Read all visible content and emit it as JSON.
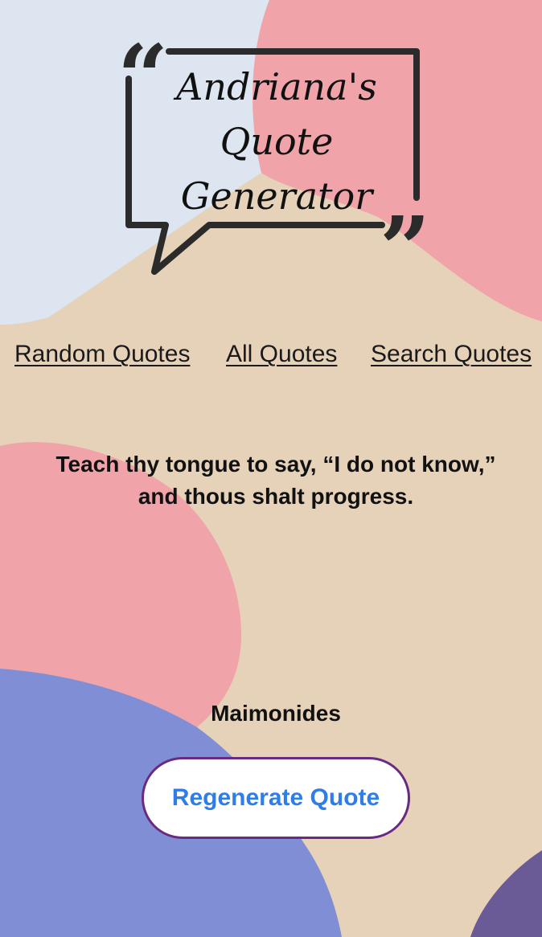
{
  "logo": {
    "line1": "Andriana's",
    "line2": "Quote",
    "line3": "Generator"
  },
  "nav": {
    "random": "Random Quotes",
    "all": "All Quotes",
    "search": "Search Quotes"
  },
  "quote": {
    "text": "Teach thy tongue to say, “I do not know,” and thous shalt progress.",
    "author": "Maimonides"
  },
  "actions": {
    "regenerate_label": "Regenerate Quote"
  },
  "colors": {
    "background": "#e6d2b9",
    "light_blue_blob": "#dde5f0",
    "pink_blob": "#f0a4a9",
    "periwinkle_blob": "#808ed5",
    "purple_blob": "#6a5a95",
    "button_border": "#6b2a82",
    "button_text": "#2f7de8"
  }
}
